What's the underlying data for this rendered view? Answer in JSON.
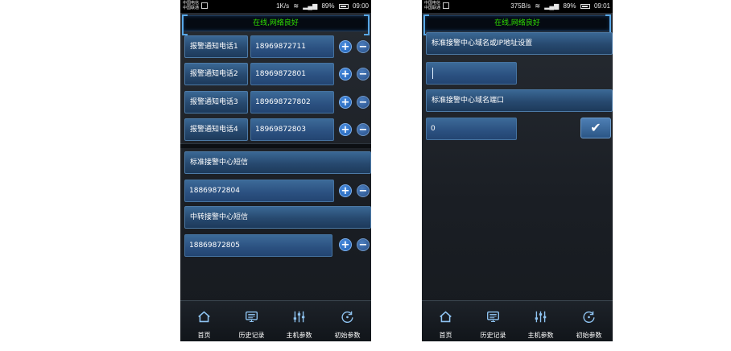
{
  "screen1": {
    "status": {
      "carrier1": "中国电信",
      "carrier2": "中国联通",
      "speed": "1K/s",
      "battery": "89%",
      "time": "09:00"
    },
    "banner": "在线,网络良好",
    "phones": [
      {
        "label": "报警通知电话1",
        "value": "18969872711"
      },
      {
        "label": "报警通知电话2",
        "value": "18969872801"
      },
      {
        "label": "报警通知电话3",
        "value": "189698727802"
      },
      {
        "label": "报警通知电话4",
        "value": "18969872803"
      }
    ],
    "sms_standard": {
      "label": "标准接警中心短信",
      "value": "18869872804"
    },
    "sms_relay": {
      "label": "中转接警中心短信",
      "value": "18869872805"
    }
  },
  "screen2": {
    "status": {
      "carrier1": "中国电信",
      "carrier2": "中国联通",
      "speed": "375B/s",
      "battery": "89%",
      "time": "09:01"
    },
    "banner": "在线,网络良好",
    "domain_label": "标准接警中心域名或IP地址设置",
    "domain_value": "",
    "port_label": "标准接警中心域名端口",
    "port_value": "0",
    "confirm_symbol": "✔"
  },
  "buttons": {
    "plus": "+",
    "minus": "−"
  },
  "nav": [
    {
      "label": "首页",
      "icon": "home-icon"
    },
    {
      "label": "历史记录",
      "icon": "monitor-history-icon"
    },
    {
      "label": "主机参数",
      "icon": "sliders-icon"
    },
    {
      "label": "初始参数",
      "icon": "reset-icon"
    }
  ],
  "colors": {
    "status_green": "#2fe000",
    "accent_blue": "#58a8e8",
    "field_blue": "#2b5080"
  }
}
